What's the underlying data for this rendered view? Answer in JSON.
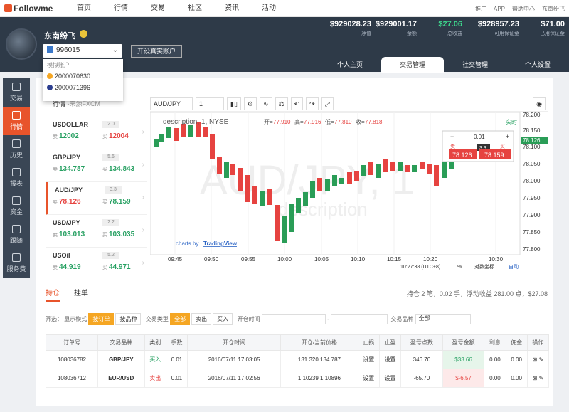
{
  "brand": "Followme",
  "nav": [
    "首页",
    "行情",
    "交易",
    "社区",
    "资讯",
    "活动"
  ],
  "topright": {
    "promote": "推广",
    "app": "APP",
    "help": "帮助中心",
    "user": "东南纷飞"
  },
  "stats": [
    {
      "v": "$929028.23",
      "l": "净值"
    },
    {
      "v": "$929001.17",
      "l": "余额"
    },
    {
      "v": "$27.06",
      "l": "总收益"
    },
    {
      "v": "$928957.23",
      "l": "可用保证金"
    },
    {
      "v": "$71.00",
      "l": "已用保证金"
    }
  ],
  "user": {
    "name": "东南纷飞",
    "account": "996015",
    "open_real": "开设真实账户"
  },
  "dropdown": {
    "header": "模拟账户",
    "items": [
      "2000070630",
      "2000071396"
    ]
  },
  "tabs": [
    "个人主页",
    "交易管理",
    "社交管理",
    "个人设置"
  ],
  "sidebar": [
    "交易",
    "行情",
    "历史",
    "报表",
    "资金",
    "跟随",
    "服务费"
  ],
  "watch": {
    "title": "行情",
    "source": "-来源FXCM",
    "items": [
      {
        "s": "USDOLLAR",
        "sp": "2.0",
        "sell": "12002",
        "buy": "12004"
      },
      {
        "s": "GBP/JPY",
        "sp": "5.6",
        "sell": "134.787",
        "buy": "134.843"
      },
      {
        "s": "AUD/JPY",
        "sp": "3.3",
        "sell": "78.126",
        "buy": "78.159"
      },
      {
        "s": "USD/JPY",
        "sp": "2.2",
        "sell": "103.013",
        "buy": "103.035"
      },
      {
        "s": "USOil",
        "sp": "5.2",
        "sell": "44.919",
        "buy": "44.971"
      }
    ],
    "sell_l": "卖",
    "buy_l": "买"
  },
  "toolbar": {
    "symbol": "AUD/JPY",
    "interval": "1"
  },
  "chart": {
    "legend": "description, 1, NYSE",
    "o": "77.910",
    "h": "77.916",
    "l": "77.810",
    "c": "77.818",
    "watermark": "AUD/JPY, 1",
    "watermark2": "description",
    "realtime": "实时",
    "by": "charts by",
    "tv": "TradingView",
    "time": "10:27:38 (UTC+8)",
    "pct": "%",
    "log": "对数坐标",
    "auto": "自动",
    "times": [
      "09:45",
      "09:50",
      "09:55",
      "10:00",
      "10:05",
      "10:10",
      "10:15",
      "10:20",
      "10:30"
    ],
    "prices": [
      "78.200",
      "78.150",
      "78.126",
      "78.100",
      "78.050",
      "78.000",
      "77.950",
      "77.900",
      "77.850",
      "77.800"
    ],
    "panel": {
      "lot": "0.01",
      "sell": "卖",
      "buy": "买",
      "spread": "3.3",
      "sellp": "78.126",
      "buyp": "78.159"
    }
  },
  "positions": {
    "tab1": "持仓",
    "tab2": "挂单",
    "summary": "持仓 2 笔，0.02 手，浮动收益 281.00 点，$27.08"
  },
  "filter": {
    "label": "筛选：",
    "display": "显示模式",
    "by_order": "按订单",
    "by_symbol": "按品种",
    "type": "交易类型",
    "all": "全部",
    "sell": "卖出",
    "buy": "买入",
    "open_time": "开仓时间",
    "symbol": "交易品种",
    "sym_all": "全部"
  },
  "table": {
    "headers": [
      "订单号",
      "交易品种",
      "类别",
      "手数",
      "开仓时间",
      "开仓/当前价格",
      "止损",
      "止盈",
      "盈亏点数",
      "盈亏金额",
      "利息",
      "佣金",
      "操作"
    ],
    "rows": [
      [
        "108036782",
        "GBP/JPY",
        "买入",
        "0.01",
        "2016/07/11 17:03:05",
        "131.320 134.787",
        "设置",
        "设置",
        "346.70",
        "$33.66",
        "0.00",
        "0.00"
      ],
      [
        "108036712",
        "EUR/USD",
        "卖出",
        "0.01",
        "2016/07/11 17:02:56",
        "1.10239 1.10896",
        "设置",
        "设置",
        "-65.70",
        "$-6.57",
        "0.00",
        "0.00"
      ]
    ]
  }
}
